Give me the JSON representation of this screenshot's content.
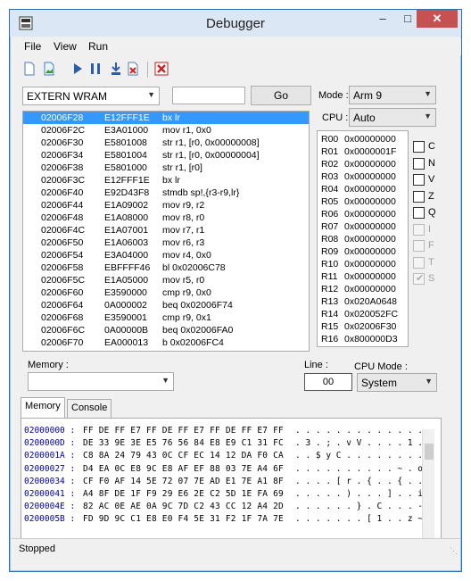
{
  "window": {
    "title": "Debugger"
  },
  "menu": {
    "file": "File",
    "view": "View",
    "run": "Run"
  },
  "toolbar": {
    "icons": [
      "new-document-icon",
      "open-image-icon",
      "run-icon",
      "pause-icon",
      "step-into-icon",
      "step-out-icon",
      "clear-breakpoints-icon",
      "stop-icon"
    ]
  },
  "memory_region": "EXTERN WRAM",
  "goto": {
    "value": "",
    "button": "Go"
  },
  "mode": {
    "label": "Mode :",
    "value": "Arm 9"
  },
  "cpu": {
    "label": "CPU :",
    "value": "Auto"
  },
  "disassembly": [
    {
      "addr": "02006F28",
      "op": "E12FFF1E",
      "ins": "bx lr",
      "selected": true
    },
    {
      "addr": "02006F2C",
      "op": "E3A01000",
      "ins": "mov r1, 0x0"
    },
    {
      "addr": "02006F30",
      "op": "E5801008",
      "ins": "str r1, [r0, 0x00000008]"
    },
    {
      "addr": "02006F34",
      "op": "E5801004",
      "ins": "str r1, [r0, 0x00000004]"
    },
    {
      "addr": "02006F38",
      "op": "E5801000",
      "ins": "str r1, [r0]"
    },
    {
      "addr": "02006F3C",
      "op": "E12FFF1E",
      "ins": "bx lr"
    },
    {
      "addr": "02006F40",
      "op": "E92D43F8",
      "ins": "stmdb sp!,{r3-r9,lr}"
    },
    {
      "addr": "02006F44",
      "op": "E1A09002",
      "ins": "mov r9, r2"
    },
    {
      "addr": "02006F48",
      "op": "E1A08000",
      "ins": "mov r8, r0"
    },
    {
      "addr": "02006F4C",
      "op": "E1A07001",
      "ins": "mov r7, r1"
    },
    {
      "addr": "02006F50",
      "op": "E1A06003",
      "ins": "mov r6, r3"
    },
    {
      "addr": "02006F54",
      "op": "E3A04000",
      "ins": "mov r4, 0x0"
    },
    {
      "addr": "02006F58",
      "op": "EBFFFF46",
      "ins": "bl 0x02006C78"
    },
    {
      "addr": "02006F5C",
      "op": "E1A05000",
      "ins": "mov r5, r0"
    },
    {
      "addr": "02006F60",
      "op": "E3590000",
      "ins": "cmp r9, 0x0"
    },
    {
      "addr": "02006F64",
      "op": "0A000002",
      "ins": "beq 0x02006F74"
    },
    {
      "addr": "02006F68",
      "op": "E3590001",
      "ins": "cmp r9, 0x1"
    },
    {
      "addr": "02006F6C",
      "op": "0A00000B",
      "ins": "beq 0x02006FA0"
    },
    {
      "addr": "02006F70",
      "op": "EA000013",
      "ins": "b 0x02006FC4"
    }
  ],
  "registers": [
    {
      "name": "R00",
      "value": "0x00000000"
    },
    {
      "name": "R01",
      "value": "0x0000001F"
    },
    {
      "name": "R02",
      "value": "0x00000000"
    },
    {
      "name": "R03",
      "value": "0x00000000"
    },
    {
      "name": "R04",
      "value": "0x00000000"
    },
    {
      "name": "R05",
      "value": "0x00000000"
    },
    {
      "name": "R06",
      "value": "0x00000000"
    },
    {
      "name": "R07",
      "value": "0x00000000"
    },
    {
      "name": "R08",
      "value": "0x00000000"
    },
    {
      "name": "R09",
      "value": "0x00000000"
    },
    {
      "name": "R10",
      "value": "0x00000000"
    },
    {
      "name": "R11",
      "value": "0x00000000"
    },
    {
      "name": "R12",
      "value": "0x00000000"
    },
    {
      "name": "R13",
      "value": "0x020A0648"
    },
    {
      "name": "R14",
      "value": "0x020052FC"
    },
    {
      "name": "R15",
      "value": "0x02006F30"
    },
    {
      "name": "R16",
      "value": "0x800000D3"
    }
  ],
  "flags": [
    {
      "name": "C",
      "enabled": true,
      "checked": false
    },
    {
      "name": "N",
      "enabled": true,
      "checked": false
    },
    {
      "name": "V",
      "enabled": true,
      "checked": false
    },
    {
      "name": "Z",
      "enabled": true,
      "checked": false
    },
    {
      "name": "Q",
      "enabled": true,
      "checked": false
    },
    {
      "name": "I",
      "enabled": false,
      "checked": false
    },
    {
      "name": "F",
      "enabled": false,
      "checked": false
    },
    {
      "name": "T",
      "enabled": false,
      "checked": false
    },
    {
      "name": "S",
      "enabled": false,
      "checked": true
    }
  ],
  "memory_label": "Memory :",
  "memory_select": "",
  "line": {
    "label": "Line :",
    "value": "00"
  },
  "cpu_mode": {
    "label": "CPU Mode :",
    "value": "System"
  },
  "tabs": [
    "Memory",
    "Console"
  ],
  "memory_dump": [
    {
      "addr": "02000000 :",
      "bytes": "FF DE FF E7 FF DE FF E7 FF DE FF E7 FF",
      "chars": ". . . . . . . . . . . . ."
    },
    {
      "addr": "0200000D :",
      "bytes": "DE 33 9E 3E E5 76 56 84 E8 E9 C1 31 FC",
      "chars": ". 3 . ; . v V . . . . 1 ."
    },
    {
      "addr": "0200001A :",
      "bytes": "C8 8A 24 79 43 0C CF EC 14 12 DA F0 CA",
      "chars": ". . $ y C . . . . . . . ."
    },
    {
      "addr": "02000027 :",
      "bytes": "D4 EA 0C E8 9C E8 AF EF 88 03 7E A4 6F",
      "chars": ". . . . . . . . . . ~ . o"
    },
    {
      "addr": "02000034 :",
      "bytes": "CF F0 AF 14 5E 72 07 7E AD E1 7E A1 8F",
      "chars": ". . . . [ r . { . . { . ."
    },
    {
      "addr": "02000041 :",
      "bytes": "A4 8F DE 1F F9 29 E6 2E C2 5D 1E FA 69",
      "chars": ". . . . . ) . . . ] . . i"
    },
    {
      "addr": "0200004E :",
      "bytes": "82 AC 0E AE 0A 9C 7D C2 43 CC 12 A4 2D",
      "chars": ". . . . . . } . C . . . -"
    },
    {
      "addr": "0200005B :",
      "bytes": "FD 9D 9C C1 E8 E0 F4 5E 31 F2 1F 7A 7E",
      "chars": ". . . . . . . [ 1 . . z ~"
    }
  ],
  "status": "Stopped"
}
